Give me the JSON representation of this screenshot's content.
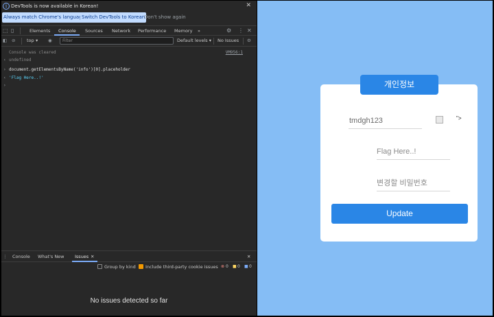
{
  "devtools": {
    "infobar": {
      "message": "DevTools is now available in Korean!",
      "btn_match": "Always match Chrome's language",
      "btn_switch": "Switch DevTools to Korean",
      "btn_dont_show": "Don't show again"
    },
    "tabs": [
      "Elements",
      "Console",
      "Sources",
      "Network",
      "Performance",
      "Memory"
    ],
    "more_tabs": "»",
    "toolbar": {
      "context": "top",
      "filter_placeholder": "Filter",
      "levels": "Default levels ▾",
      "issues": "No Issues"
    },
    "console": {
      "cleared": "Console was cleared",
      "cleared_source": "VM956:1",
      "undefined": "undefined",
      "command": "document.getElementsByName('info')[0].placeholder",
      "result": "'Flag Here..!'"
    },
    "drawer": {
      "tabs": [
        "Console",
        "What's New",
        "Issues"
      ],
      "group_by_kind": "Group by kind",
      "include_third_party": "Include third-party cookie issues",
      "badge_errors": "0",
      "badge_warnings": "0",
      "badge_info": "0",
      "empty": "No issues detected so far"
    }
  },
  "page": {
    "header": "개인정보",
    "username": "tmdgh123",
    "stray_text": "\">",
    "flag_placeholder": "Flag Here..!",
    "password_placeholder": "변경할 비밀번호",
    "update_label": "Update"
  },
  "colors": {
    "page_bg": "#85bdf5",
    "accent": "#2a86e6",
    "devtools_bg": "#282828"
  }
}
